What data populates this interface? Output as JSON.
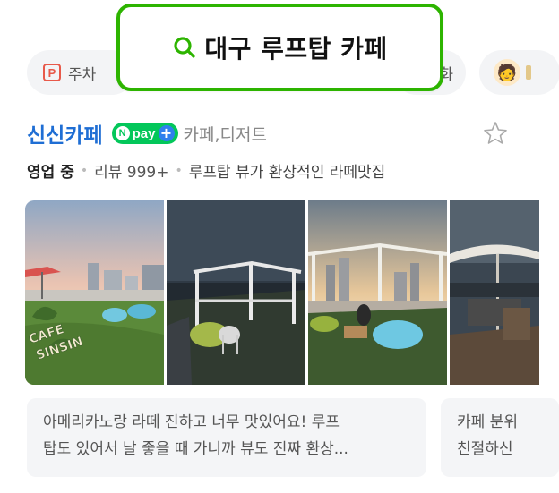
{
  "search": {
    "query": "대구 루프탑 카페"
  },
  "filters": {
    "parking_label": "주차",
    "mid_label_fragment": "화"
  },
  "place": {
    "name": "신신카페",
    "npay": {
      "n": "N",
      "label": "pay",
      "plus": "+"
    },
    "category": "카페,디저트",
    "status": "영업 중",
    "reviews": "리뷰 999+",
    "description": "루프탑 뷰가 환상적인 라떼맛집",
    "photo_overlay_text": [
      "CAFE",
      "SINSIN"
    ]
  },
  "review_cards": [
    {
      "lines": [
        "아메리카노랑 라떼 진하고 너무 맛있어요! 루프",
        "탑도 있어서 날 좋을 때 가니까 뷰도 진짜 환상..."
      ]
    },
    {
      "lines": [
        "카페 분위",
        "친절하신"
      ]
    }
  ],
  "colors": {
    "search_border": "#2db400",
    "place_name": "#1f6ed4",
    "npay_green": "#03c75a",
    "parking_red": "#e8594a"
  },
  "icons": {
    "search": "search-icon",
    "parking": "parking-icon",
    "chef": "chef-icon",
    "star": "star-icon"
  }
}
